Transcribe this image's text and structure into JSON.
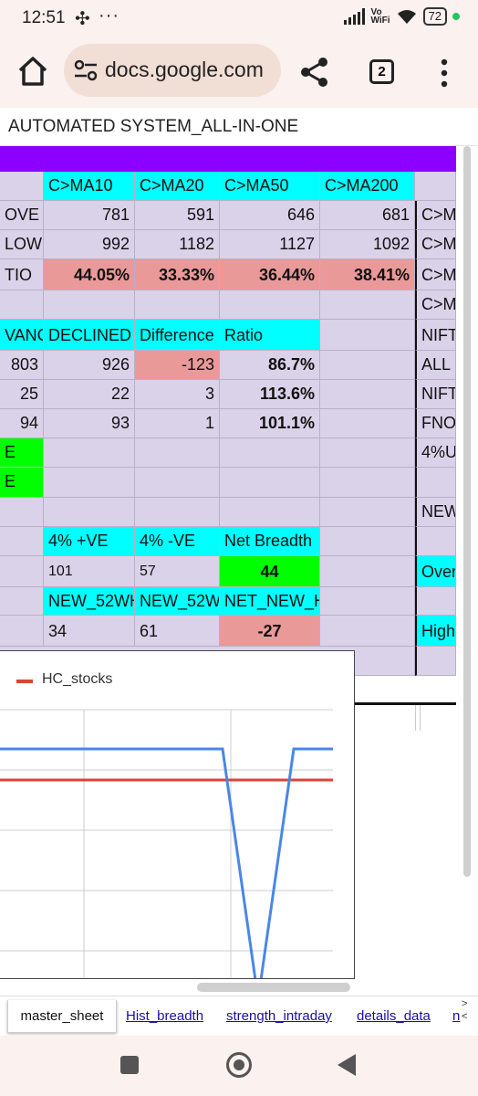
{
  "status_bar": {
    "time": "12:51",
    "battery": "72",
    "network": "Vo\nWiFi"
  },
  "browser": {
    "url": "docs.google.com",
    "tab_count": "2"
  },
  "doc": {
    "title": "AUTOMATED SYSTEM_ALL-IN-ONE"
  },
  "sheet": {
    "headers": [
      "C>MA10",
      "C>MA20",
      "C>MA50",
      "C>MA200"
    ],
    "rows": [
      {
        "label": "OVE",
        "values": [
          "781",
          "591",
          "646",
          "681"
        ],
        "side": "C>M"
      },
      {
        "label": "LOW",
        "values": [
          "992",
          "1182",
          "1127",
          "1092"
        ],
        "side": "C>M"
      },
      {
        "label": "TIO",
        "values": [
          "44.05%",
          "33.33%",
          "36.44%",
          "38.41%"
        ],
        "side": "C>M"
      },
      {
        "side": "C>M"
      }
    ],
    "adv_headers": [
      "VANCI",
      "DECLINED",
      "Difference",
      "Ratio"
    ],
    "adv_rows": [
      {
        "values": [
          "803",
          "926",
          "-123",
          "86.7%"
        ],
        "side": "NIFT"
      },
      {
        "values": [
          "25",
          "22",
          "3",
          "113.6%"
        ],
        "side": "ALL"
      },
      {
        "values": [
          "94",
          "93",
          "1",
          "101.1%"
        ],
        "side": "NIFT"
      }
    ],
    "extra_side": [
      "FNO",
      "4%U",
      "NEW"
    ],
    "green_marks": [
      "E",
      "E"
    ],
    "breadth_headers": [
      "4% +VE",
      "4% -VE",
      "Net Breadth"
    ],
    "breadth_values": [
      "101",
      "57",
      "44"
    ],
    "side_over": "Over",
    "new_headers": [
      "NEW_52WH",
      "NEW_52W",
      "NET_NEW_HL"
    ],
    "new_values": [
      "34",
      "61",
      "-27"
    ],
    "side_high": "High"
  },
  "chart_data": {
    "type": "line",
    "series": [
      {
        "name": "HC_stocks",
        "color": "#db4437",
        "values": [
          1,
          1,
          1,
          1,
          1,
          1,
          1,
          1
        ]
      },
      {
        "name": "",
        "color": "#4a86e8",
        "values": [
          2,
          2,
          2,
          2,
          2,
          2,
          -1,
          2
        ]
      }
    ],
    "legend": "top-left",
    "grid": true
  },
  "tabs": {
    "active": "master_sheet",
    "links": [
      "Hist_breadth",
      "strength_intraday",
      "details_data",
      "n"
    ]
  }
}
